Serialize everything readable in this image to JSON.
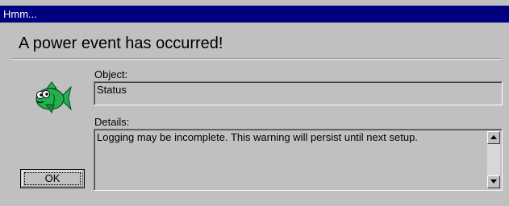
{
  "window": {
    "title": "Hmm..."
  },
  "dialog": {
    "heading": "A power event has occurred!",
    "object_label": "Object:",
    "object_value": "Status",
    "details_label": "Details:",
    "details_value": "Logging may be incomplete. This warning will persist until next setup.",
    "ok_label": "OK"
  },
  "icons": {
    "dialog_icon": "fish-icon",
    "scroll_up": "scroll-up-arrow-icon",
    "scroll_down": "scroll-down-arrow-icon"
  },
  "colors": {
    "titlebar": "#000080",
    "face": "#c0c0c0",
    "fish_body": "#22b14c"
  }
}
